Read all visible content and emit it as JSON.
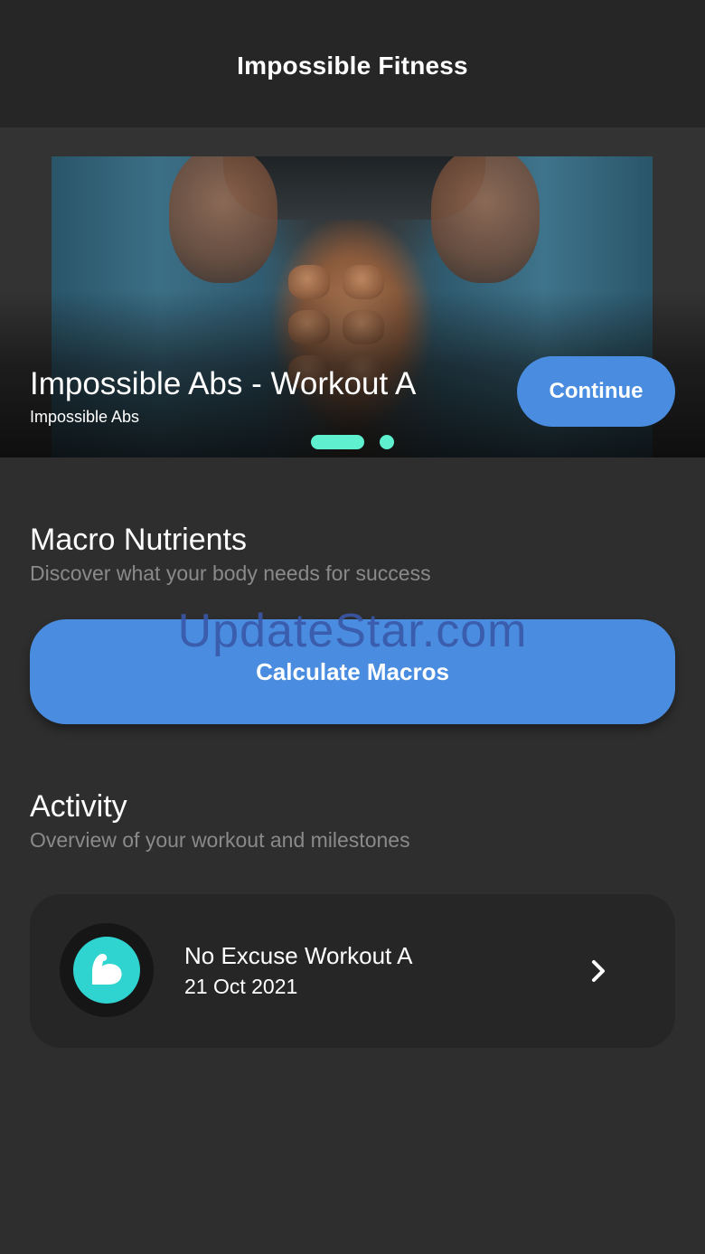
{
  "app_bar": {
    "title": "Impossible Fitness"
  },
  "hero": {
    "title": "Impossible Abs - Workout A",
    "subtitle": "Impossible Abs",
    "continue_label": "Continue",
    "page_count": 2,
    "active_page": 1
  },
  "macros": {
    "title": "Macro Nutrients",
    "subtitle": "Discover what your body needs for success",
    "button_label": "Calculate Macros"
  },
  "watermark": "UpdateStar.com",
  "activity": {
    "title": "Activity",
    "subtitle": "Overview of your workout and milestones",
    "items": [
      {
        "name": "No Excuse Workout A",
        "date": "21 Oct 2021",
        "icon": "flexed-bicep-icon"
      }
    ]
  },
  "colors": {
    "accent": "#4a8de0",
    "indicator": "#5ef0cf",
    "icon_teal": "#2fd3cf",
    "background": "#2e2e2e",
    "app_bar": "#262626"
  }
}
